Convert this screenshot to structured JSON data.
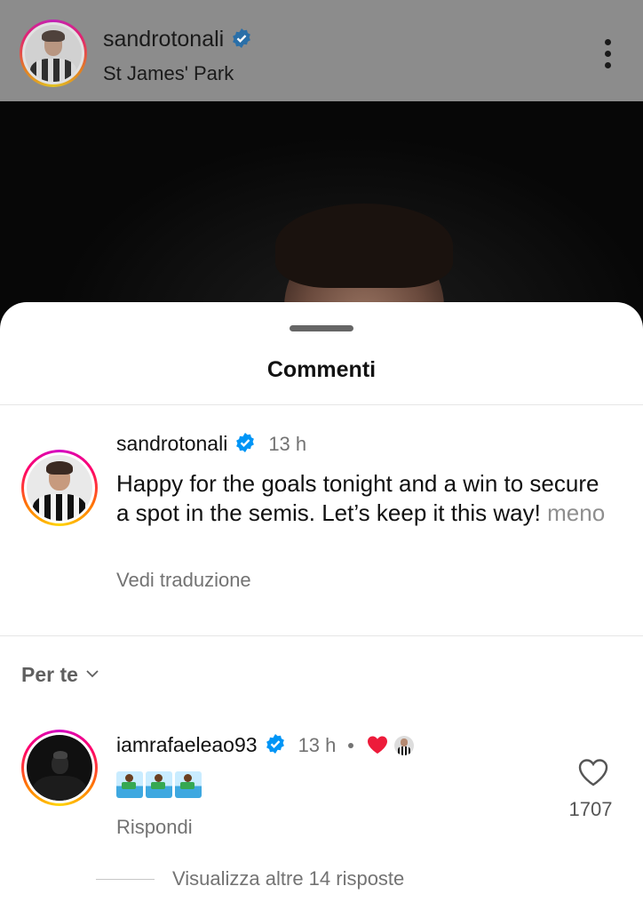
{
  "post": {
    "username": "sandrotonali",
    "location": "St James' Park"
  },
  "sheet": {
    "title": "Commenti"
  },
  "caption": {
    "username": "sandrotonali",
    "time": "13 h",
    "text": "Happy for the goals tonight and a win to secure a spot in the semis. Let’s keep it this way!",
    "less_label": "meno",
    "translate_label": "Vedi traduzione"
  },
  "filter": {
    "label": "Per te"
  },
  "comment": {
    "username": "iamrafaeleao93",
    "time": "13 h",
    "reply_label": "Rispondi",
    "like_count": "1707",
    "more_replies_label": "Visualizza altre 14 risposte",
    "emoji": [
      "surfer-icon",
      "surfer-icon",
      "surfer-icon"
    ]
  },
  "colors": {
    "verified": "#0095f6",
    "like_red": "#ed1b3a",
    "muted_text": "#737373"
  }
}
